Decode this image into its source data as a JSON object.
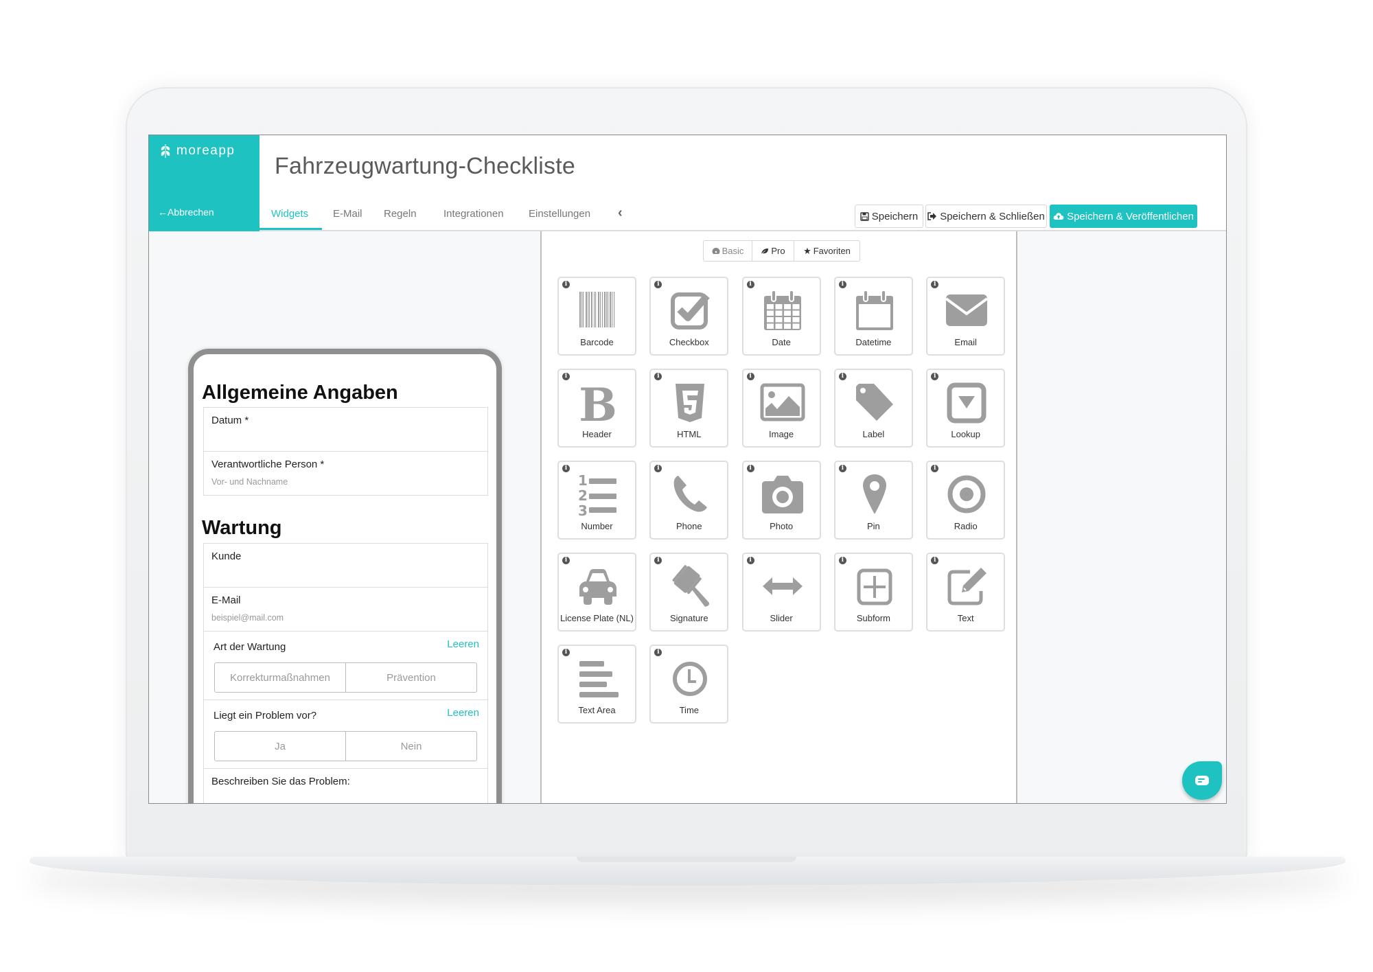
{
  "app": {
    "brand": "moreapp",
    "cancel_label": "Abbrechen",
    "title": "Fahrzeugwartung-Checkliste",
    "accent_color": "#1ec2c1"
  },
  "tabs": [
    {
      "label": "Widgets",
      "active": true
    },
    {
      "label": "E-Mail",
      "active": false
    },
    {
      "label": "Regeln",
      "active": false
    },
    {
      "label": "Integrationen",
      "active": false
    },
    {
      "label": "Einstellungen",
      "active": false
    }
  ],
  "collapse_icon": "chevron-left-icon",
  "header_buttons": {
    "save": {
      "label": "Speichern",
      "icon": "floppy-disk-icon"
    },
    "save_close": {
      "label": "Speichern & Schließen",
      "icon": "sign-out-icon"
    },
    "save_publish": {
      "label": "Speichern & Veröffentlichen",
      "icon": "cloud-upload-icon"
    }
  },
  "form_preview": {
    "sections": [
      {
        "heading": "Allgemeine Angaben"
      },
      {
        "heading": "Wartung"
      }
    ],
    "fields": {
      "datum": {
        "label": "Datum *"
      },
      "person": {
        "label": "Verantwortliche Person *",
        "placeholder": "Vor- und Nachname"
      },
      "kunde": {
        "label": "Kunde"
      },
      "email": {
        "label": "E-Mail",
        "placeholder": "beispiel@mail.com"
      },
      "art": {
        "label": "Art der Wartung",
        "clear_label": "Leeren",
        "options": [
          "Korrekturmaßnahmen",
          "Prävention"
        ]
      },
      "problem": {
        "label": "Liegt ein Problem vor?",
        "clear_label": "Leeren",
        "options": [
          "Ja",
          "Nein"
        ]
      },
      "beschreiben": {
        "label": "Beschreiben Sie das Problem:"
      }
    }
  },
  "widget_filter": [
    {
      "label": "Basic",
      "icon": "dashboard-icon"
    },
    {
      "label": "Pro",
      "icon": "leaf-icon"
    },
    {
      "label": "Favoriten",
      "icon": "star-icon"
    }
  ],
  "widgets": [
    {
      "label": "Barcode",
      "icon": "barcode-icon"
    },
    {
      "label": "Checkbox",
      "icon": "checkbox-icon"
    },
    {
      "label": "Date",
      "icon": "calendar-icon"
    },
    {
      "label": "Datetime",
      "icon": "calendar-blank-icon"
    },
    {
      "label": "Email",
      "icon": "envelope-icon"
    },
    {
      "label": "Header",
      "icon": "bold-icon"
    },
    {
      "label": "HTML",
      "icon": "html5-icon"
    },
    {
      "label": "Image",
      "icon": "picture-icon"
    },
    {
      "label": "Label",
      "icon": "tag-icon"
    },
    {
      "label": "Lookup",
      "icon": "dropdown-icon"
    },
    {
      "label": "Number",
      "icon": "ordered-list-icon"
    },
    {
      "label": "Phone",
      "icon": "phone-icon"
    },
    {
      "label": "Photo",
      "icon": "camera-icon"
    },
    {
      "label": "Pin",
      "icon": "map-marker-icon"
    },
    {
      "label": "Radio",
      "icon": "radio-icon"
    },
    {
      "label": "License Plate (NL)",
      "icon": "car-icon"
    },
    {
      "label": "Signature",
      "icon": "gavel-icon"
    },
    {
      "label": "Slider",
      "icon": "arrows-h-icon"
    },
    {
      "label": "Subform",
      "icon": "plus-square-icon"
    },
    {
      "label": "Text",
      "icon": "edit-icon"
    },
    {
      "label": "Text Area",
      "icon": "align-left-icon"
    },
    {
      "label": "Time",
      "icon": "clock-icon"
    }
  ],
  "chat_icon": "chat-bubble-icon"
}
